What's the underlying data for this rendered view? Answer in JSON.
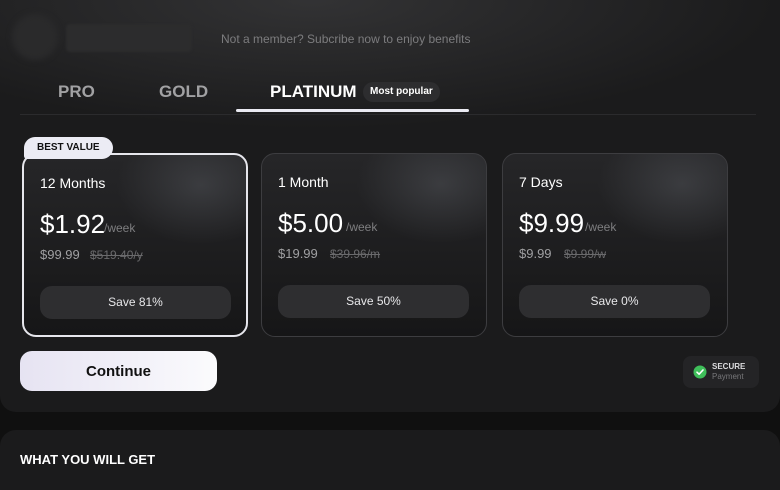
{
  "header": {
    "subscribe_text": "Not a member? Subcribe now to enjoy benefits"
  },
  "tabs": [
    {
      "label": "PRO",
      "active": false
    },
    {
      "label": "GOLD",
      "active": false
    },
    {
      "label": "PLATINUM",
      "active": true,
      "badge": "Most popular"
    }
  ],
  "plans": [
    {
      "badge": "BEST VALUE",
      "duration": "12 Months",
      "price": "$1.92",
      "per": "/week",
      "total": "$99.99",
      "old_price": "$519.40/y",
      "save": "Save 81%",
      "selected": true
    },
    {
      "duration": "1 Month",
      "price": "$5.00",
      "per": "/week",
      "total": "$19.99",
      "old_price": "$39.96/m",
      "save": "Save 50%",
      "selected": false
    },
    {
      "duration": "7 Days",
      "price": "$9.99",
      "per": "/week",
      "total": "$9.99",
      "old_price": "$9.99/w",
      "save": "Save 0%",
      "selected": false
    }
  ],
  "continue_label": "Continue",
  "secure": {
    "title": "SECURE",
    "subtitle": "Payment",
    "icon": "shield-check-icon",
    "color": "#3fbf5a"
  },
  "section": {
    "title": "WHAT YOU WILL GET"
  },
  "colors": {
    "background": "#101010",
    "panel": "#1b1b1c",
    "accent": "#ececf4"
  }
}
